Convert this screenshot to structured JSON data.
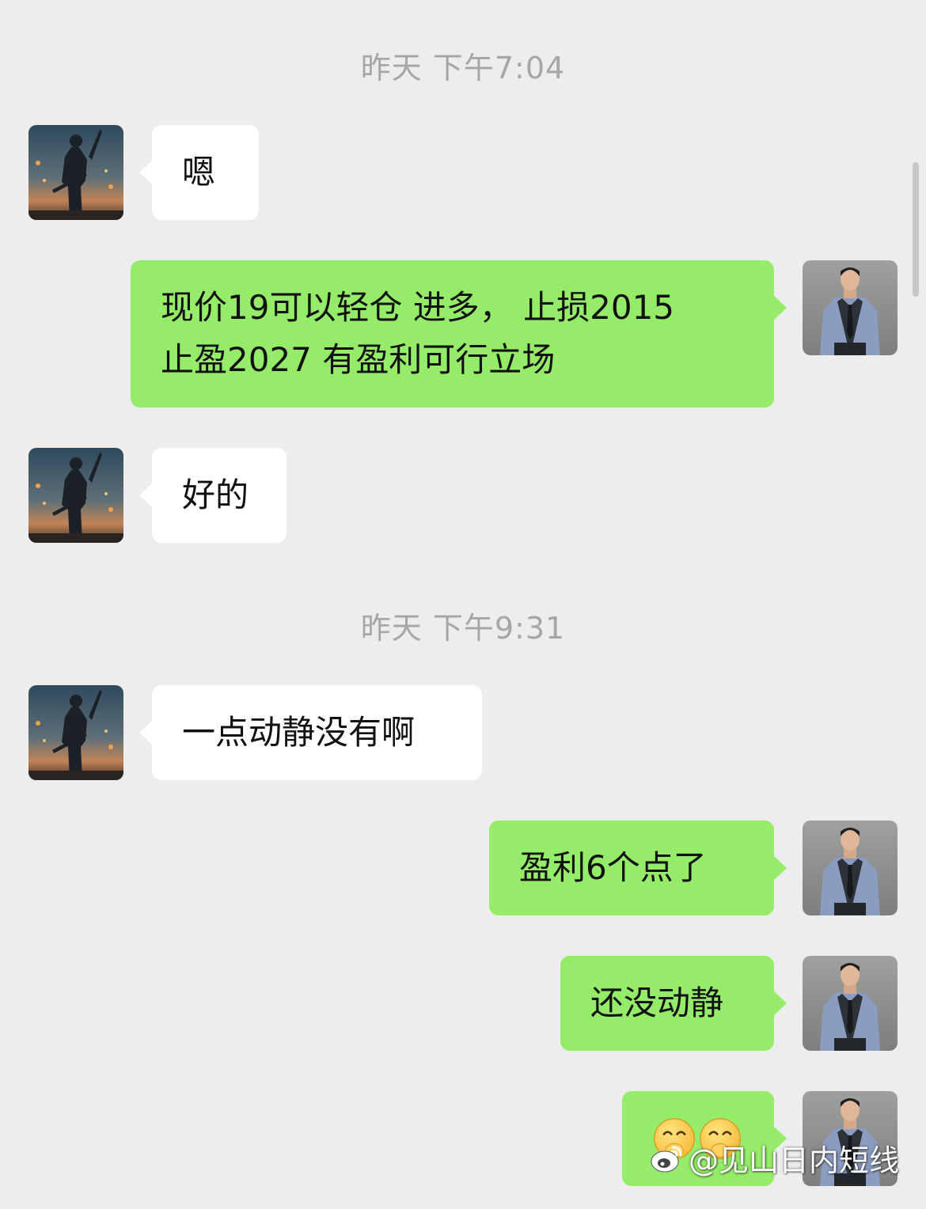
{
  "chat": {
    "timestamps": [
      "昨天 下午7:04",
      "昨天 下午9:31"
    ],
    "messages": [
      {
        "side": "left",
        "text": "嗯"
      },
      {
        "side": "right",
        "lines": [
          "现价19可以轻仓 进多， 止损2015",
          "止盈2027 有盈利可行立场"
        ]
      },
      {
        "side": "left",
        "text": "好的"
      },
      {
        "side": "left",
        "text": "一点动静没有啊"
      },
      {
        "side": "right",
        "text": "盈利6个点了"
      },
      {
        "side": "right",
        "text": "还没动静"
      },
      {
        "side": "right",
        "emojis": [
          "grin-face-emoji",
          "grin-face-emoji"
        ]
      }
    ]
  },
  "watermark": {
    "text": "@见山日内短线",
    "icon": "weibo-logo-icon"
  },
  "colors": {
    "background": "#ededed",
    "incoming_bubble": "#ffffff",
    "outgoing_bubble": "#95ec69",
    "timestamp": "#a6a6a6"
  }
}
